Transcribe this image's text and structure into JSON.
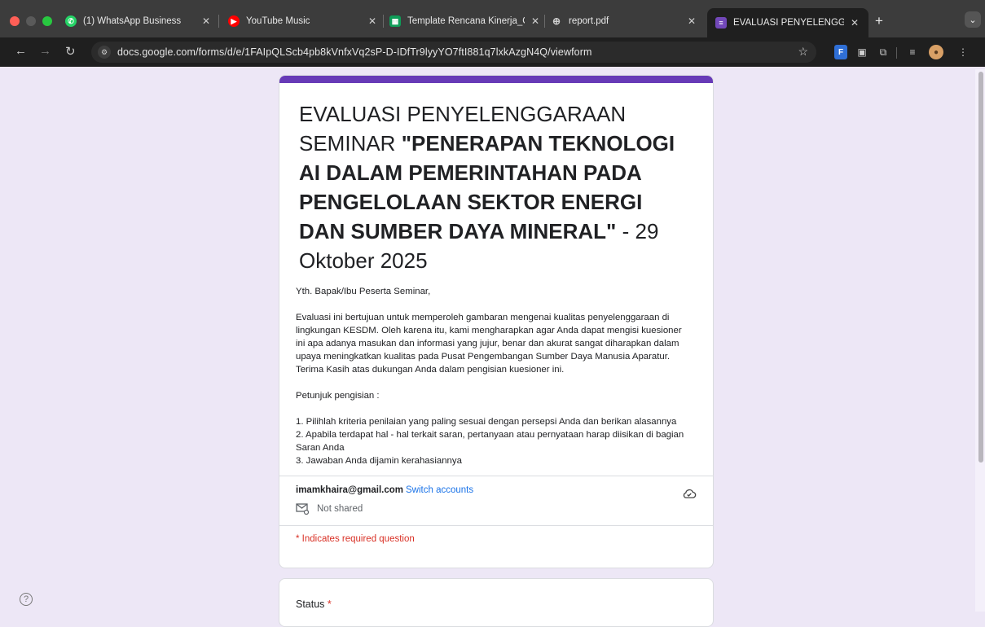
{
  "browser": {
    "tabs": [
      {
        "title": "(1) WhatsApp Business",
        "favicon": "whatsapp-icon",
        "color": "#25d366"
      },
      {
        "title": "YouTube Music",
        "favicon": "youtube-music-icon",
        "color": "#ff0000"
      },
      {
        "title": "Template Rencana Kinerja_O",
        "favicon": "google-sheets-icon",
        "color": "#0f9d58"
      },
      {
        "title": "report.pdf",
        "favicon": "globe-icon",
        "color": "#9aa0a6"
      },
      {
        "title": "EVALUASI PENYELENGGARA",
        "favicon": "google-forms-icon",
        "color": "#7248b9",
        "active": true
      }
    ],
    "url": "docs.google.com/forms/d/e/1FAIpQLScb4pb8kVnfxVq2sP-D-IDfTr9lyyYO7ftI881q7lxkAzgN4Q/viewform"
  },
  "form": {
    "accent_color": "#673ab7",
    "title_prefix": "EVALUASI PENYELENGGARAAN SEMINAR ",
    "title_bold": "\"PENERAPAN TEKNOLOGI AI DALAM PEMERINTAHAN PADA PENGELOLAAN SEKTOR ENERGI DAN SUMBER DAYA MINERAL\"",
    "title_suffix": " - 29 Oktober 2025",
    "greeting": "Yth. Bapak/Ibu Peserta Seminar,",
    "intro": "Evaluasi ini bertujuan untuk memperoleh gambaran mengenai kualitas penyelenggaraan di lingkungan KESDM. Oleh karena itu, kami mengharapkan agar Anda dapat mengisi kuesioner ini apa adanya masukan dan informasi yang jujur, benar dan akurat sangat diharapkan dalam upaya meningkatkan kualitas pada Pusat Pengembangan Sumber Daya Manusia Aparatur. Terima Kasih atas dukungan Anda dalam pengisian kuesioner ini.",
    "instructions_heading": "Petunjuk pengisian :",
    "instructions": [
      "1. Pilihlah kriteria penilaian yang paling sesuai dengan persepsi Anda dan berikan alasannya",
      "2. Apabila terdapat hal - hal terkait saran, pertanyaan atau pernyataan harap diisikan di bagian Saran Anda",
      "3. Jawaban Anda dijamin kerahasiannya"
    ],
    "account_email": "imamkhaira@gmail.com",
    "switch_accounts": "Switch accounts",
    "not_shared": "Not shared",
    "required_note": "* Indicates required question",
    "question_label": "Status",
    "question_required_mark": "*"
  }
}
